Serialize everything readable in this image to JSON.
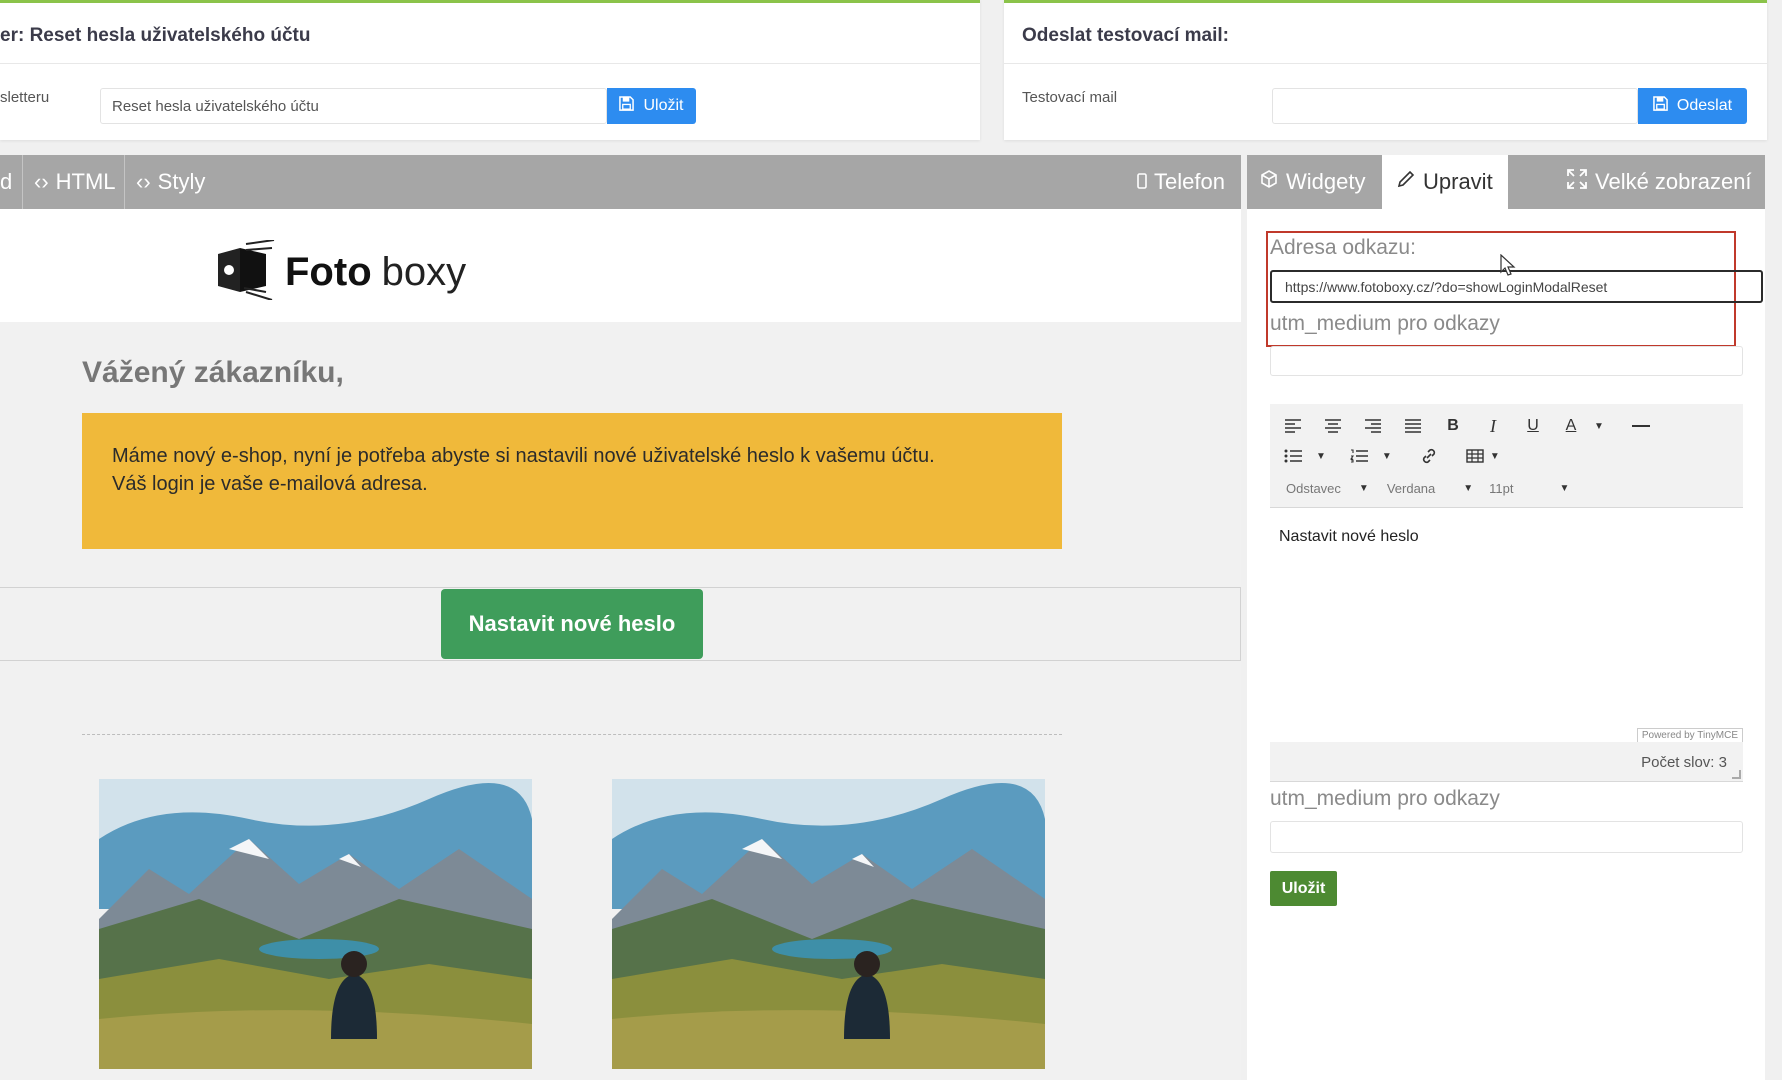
{
  "top_left": {
    "title": "er: Reset hesla uživatelského účtu",
    "field_label": "sletteru",
    "field_value": "Reset hesla uživatelského účtu",
    "save_label": "Uložit"
  },
  "top_right": {
    "title": "Odeslat testovací mail:",
    "field_label": "Testovací mail",
    "field_value": "",
    "send_label": "Odeslat"
  },
  "editor_toolbar": {
    "partial_tab": "d",
    "html_tab": "HTML",
    "styles_tab": "Styly",
    "phone_tab": "Telefon"
  },
  "side_toolbar": {
    "widgets_tab": "Widgety",
    "edit_tab": "Upravit",
    "fullscreen_tab": "Velké zobrazení"
  },
  "email": {
    "logo_bold": "Foto",
    "logo_light": "boxy",
    "greeting": "Vážený zákazníku,",
    "notice_line1": "Máme nový e-shop, nyní je potřeba abyste si nastavili nové uživatelské heslo k vašemu účtu.",
    "notice_line2": "Váš login je vaše e-mailová adresa.",
    "cta": "Nastavit nové heslo"
  },
  "panel": {
    "link_label": "Adresa odkazu:",
    "link_value": "https://www.fotoboxy.cz/?do=showLoginModalReset",
    "utm_label_1": "utm_medium pro odkazy",
    "utm_value_1": "",
    "format_select": "Odstavec",
    "font_select": "Verdana",
    "size_select": "11pt",
    "editor_content": "Nastavit nové heslo",
    "powered_by": "Powered by TinyMCE",
    "word_count": "Počet slov: 3",
    "utm_label_2": "utm_medium pro odkazy",
    "utm_value_2": "",
    "save_label": "Uložit"
  },
  "colors": {
    "accent_green": "#8bc34a",
    "blue": "#2d8cf0",
    "toolbar_gray": "#a6a6a6",
    "notice_yellow": "#f0b93a",
    "cta_green": "#3f9d5b",
    "save_green": "#4d8a32",
    "highlight_red": "#c0392b"
  }
}
